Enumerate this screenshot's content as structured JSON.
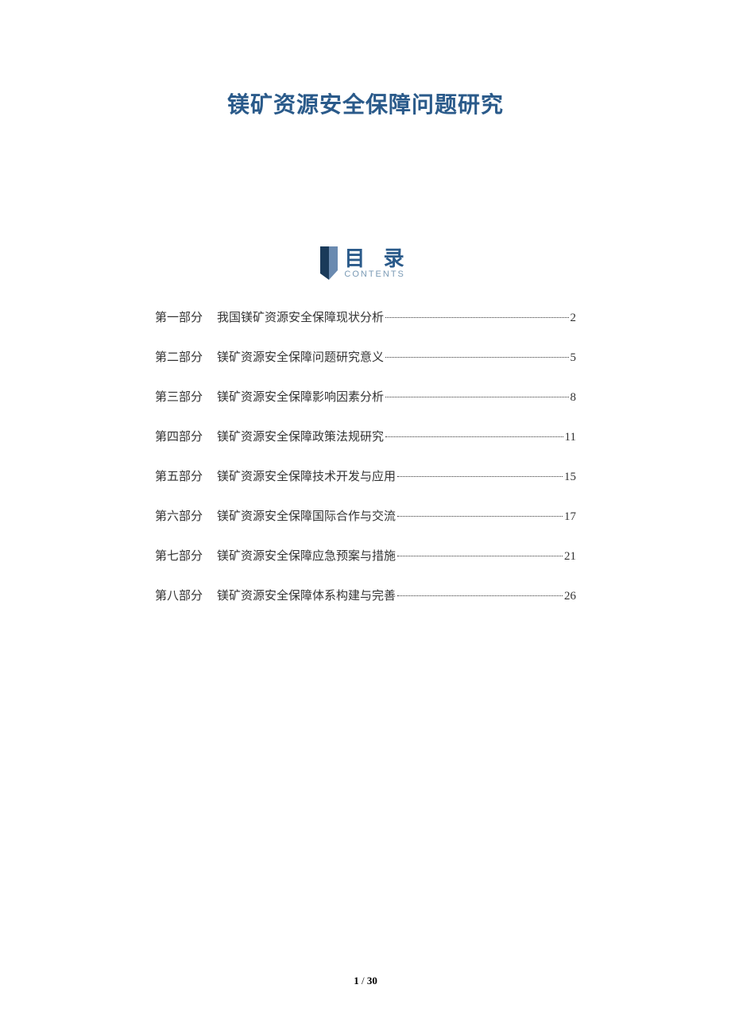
{
  "title": "镁矿资源安全保障问题研究",
  "toc": {
    "label": "目 录",
    "sublabel": "CONTENTS",
    "entries": [
      {
        "part": "第一部分",
        "text": "我国镁矿资源安全保障现状分析",
        "page": "2"
      },
      {
        "part": "第二部分",
        "text": "镁矿资源安全保障问题研究意义",
        "page": "5"
      },
      {
        "part": "第三部分",
        "text": "镁矿资源安全保障影响因素分析",
        "page": "8"
      },
      {
        "part": "第四部分",
        "text": "镁矿资源安全保障政策法规研究",
        "page": "11"
      },
      {
        "part": "第五部分",
        "text": "镁矿资源安全保障技术开发与应用",
        "page": "15"
      },
      {
        "part": "第六部分",
        "text": "镁矿资源安全保障国际合作与交流",
        "page": "17"
      },
      {
        "part": "第七部分",
        "text": "镁矿资源安全保障应急预案与措施",
        "page": "21"
      },
      {
        "part": "第八部分",
        "text": "镁矿资源安全保障体系构建与完善",
        "page": "26"
      }
    ]
  },
  "footer": {
    "current": "1",
    "sep": " / ",
    "total": "30"
  }
}
